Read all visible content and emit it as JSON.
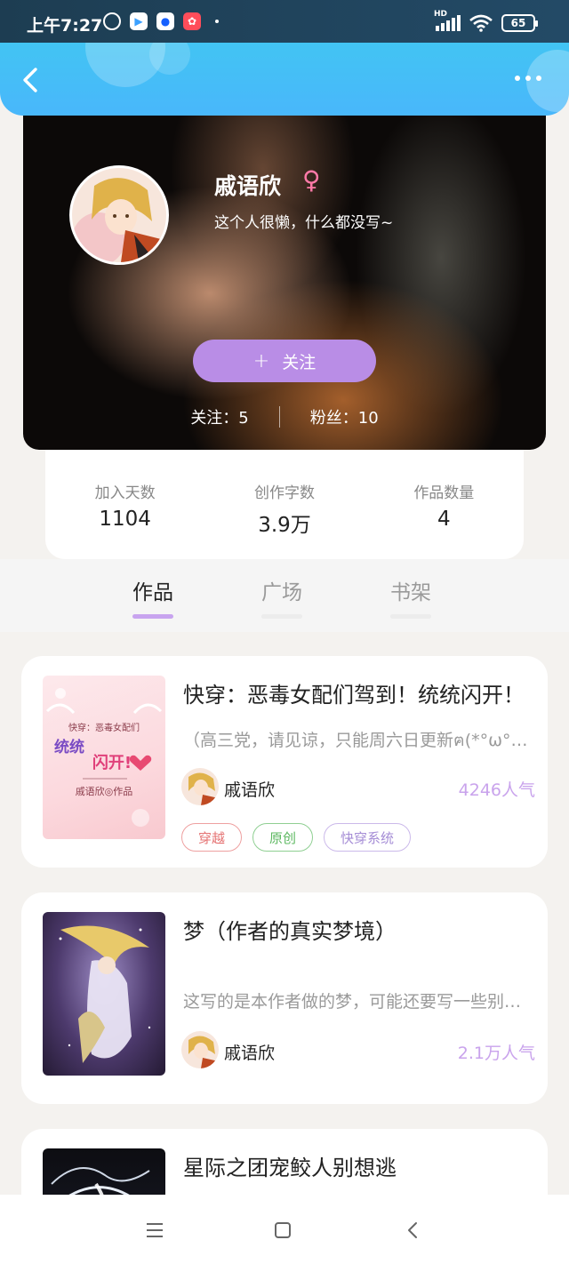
{
  "status_bar": {
    "time": "上午7:27",
    "network_label": "HD",
    "battery_level": "65"
  },
  "profile": {
    "name": "戚语欣",
    "gender_symbol": "♀",
    "bio": "这个人很懒，什么都没写~",
    "follow_button": {
      "icon": "+",
      "label": "关注"
    },
    "following": "关注：5",
    "fans": "粉丝：10"
  },
  "stats": [
    {
      "label": "加入天数",
      "value": "1104"
    },
    {
      "label": "创作字数",
      "value": "3.9万"
    },
    {
      "label": "作品数量",
      "value": "4"
    }
  ],
  "tabs": [
    {
      "label": "作品",
      "active": true
    },
    {
      "label": "广场",
      "active": false
    },
    {
      "label": "书架",
      "active": false
    }
  ],
  "works": [
    {
      "title": "快穿：恶毒女配们驾到！统统闪开！",
      "cover_text": {
        "line1": "快穿：恶毒女配们",
        "line2": "统统",
        "line3": "闪开!",
        "line4": "戚语欣◎作品"
      },
      "description": "（高三党，请见谅，只能周六日更新ฅ(*°ω°*ฅ)*",
      "author": "戚语欣",
      "popularity": "4246人气",
      "tags": [
        {
          "label": "穿越",
          "color": "#e57373"
        },
        {
          "label": "原创",
          "color": "#66bb6a"
        },
        {
          "label": "快穿系统",
          "color": "#b39ddb"
        }
      ]
    },
    {
      "title": "梦（作者的真实梦境）",
      "description": "这写的是本作者做的梦，可能还要写一些别的梦",
      "author": "戚语欣",
      "popularity": "2.1万人气",
      "tags": []
    },
    {
      "title": "星际之团宠鲛人别想逃"
    }
  ],
  "colors": {
    "accent": "#b98de6",
    "nav_blue": "#45bff5",
    "popularity": "#c9a3ec"
  }
}
